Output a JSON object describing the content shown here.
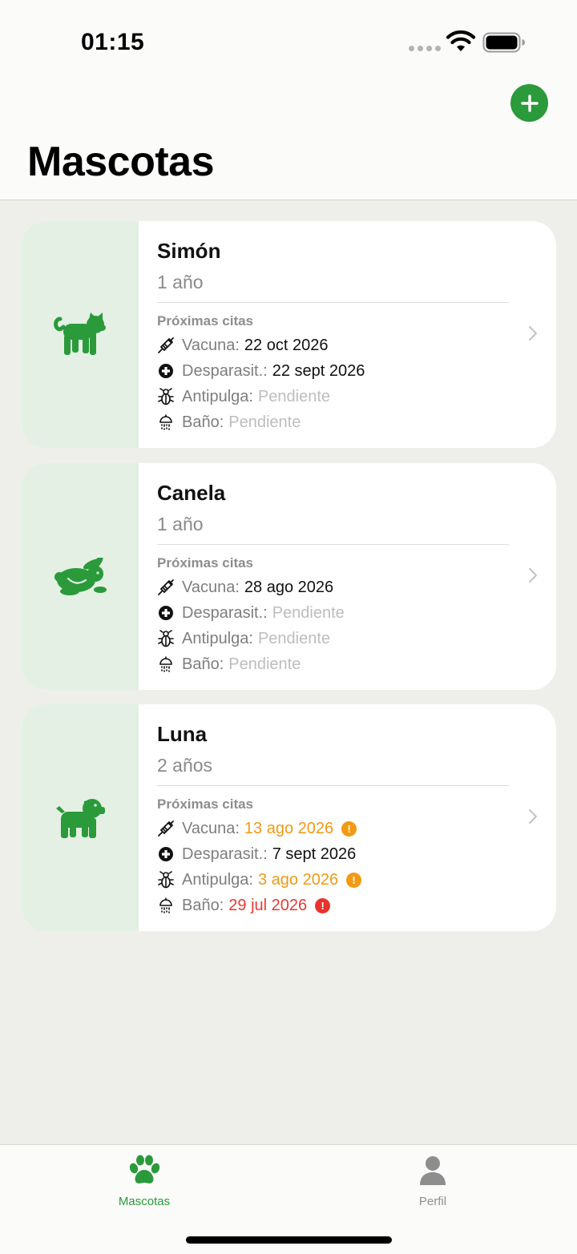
{
  "status": {
    "time": "01:15"
  },
  "header": {
    "title": "Mascotas"
  },
  "section_label": "Próximas citas",
  "labels": {
    "vaccine": "Vacuna:",
    "deworm": "Desparasit.:",
    "flea": "Antipulga:",
    "bath": "Baño:"
  },
  "pets": [
    {
      "name": "Simón",
      "age": "1 año",
      "species_icon": "cat-icon",
      "vaccine": "22 oct 2026",
      "deworm": "22 sept 2026",
      "flea": "Pendiente",
      "bath": "Pendiente"
    },
    {
      "name": "Canela",
      "age": "1 año",
      "species_icon": "rabbit-icon",
      "vaccine": "28 ago 2026",
      "deworm": "Pendiente",
      "flea": "Pendiente",
      "bath": "Pendiente"
    },
    {
      "name": "Luna",
      "age": "2 años",
      "species_icon": "dog-icon",
      "vaccine": "13 ago 2026",
      "deworm": "7 sept 2026",
      "flea": "3 ago 2026",
      "bath": "29 jul 2026"
    }
  ],
  "badge_symbol": "!",
  "tabs": [
    {
      "label": "Mascotas",
      "icon": "paw-icon",
      "active": true
    },
    {
      "label": "Perfil",
      "icon": "person-icon",
      "active": false
    }
  ],
  "colors": {
    "accent": "#2a9a3a",
    "warning": "#ef9a14",
    "alert": "#e63a33",
    "pending": "#bdbdbd"
  }
}
